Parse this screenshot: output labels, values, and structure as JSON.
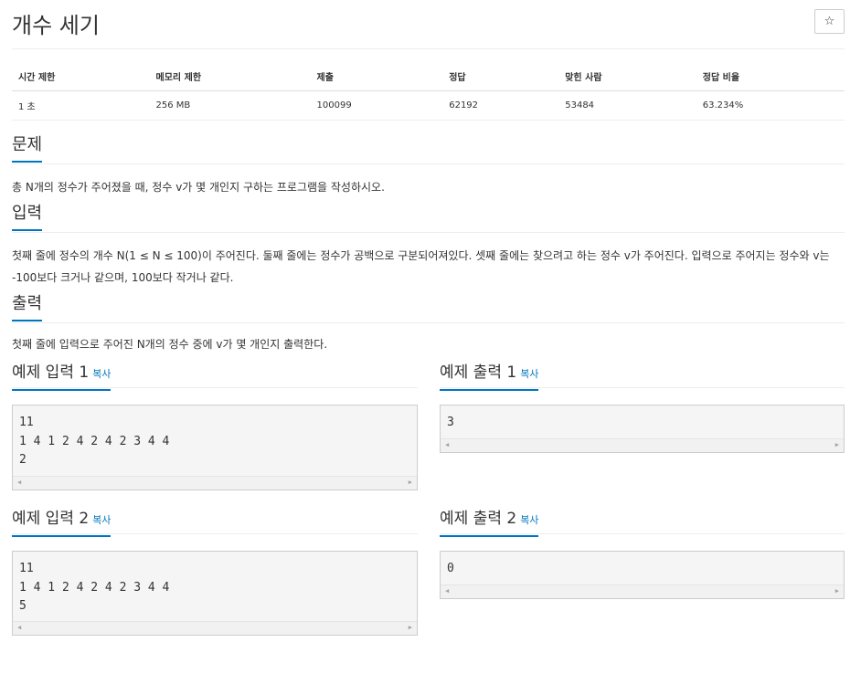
{
  "header": {
    "title": "개수 세기",
    "star_label": "☆"
  },
  "info_table": {
    "headers": [
      "시간 제한",
      "메모리 제한",
      "제출",
      "정답",
      "맞힌 사람",
      "정답 비율"
    ],
    "values": [
      "1 초",
      "256 MB",
      "100099",
      "62192",
      "53484",
      "63.234%"
    ]
  },
  "sections": {
    "problem": {
      "title": "문제",
      "text": "총 N개의 정수가 주어졌을 때, 정수 v가 몇 개인지 구하는 프로그램을 작성하시오."
    },
    "input": {
      "title": "입력",
      "text": "첫째 줄에 정수의 개수 N(1 ≤ N ≤ 100)이 주어진다. 둘째 줄에는 정수가 공백으로 구분되어져있다. 셋째 줄에는 찾으려고 하는 정수 v가 주어진다. 입력으로 주어지는 정수와 v는 -100보다 크거나 같으며, 100보다 작거나 같다."
    },
    "output": {
      "title": "출력",
      "text": "첫째 줄에 입력으로 주어진 N개의 정수 중에 v가 몇 개인지 출력한다."
    }
  },
  "examples": {
    "copy_label": "복사",
    "input1": {
      "title": "예제 입력 1",
      "lines": [
        "11",
        "1 4 1 2 4 2 4 2 3 4 4",
        "2"
      ]
    },
    "output1": {
      "title": "예제 출력 1",
      "lines": [
        "3"
      ]
    },
    "input2": {
      "title": "예제 입력 2",
      "lines": [
        "11",
        "1 4 1 2 4 2 4 2 3 4 4",
        "5"
      ]
    },
    "output2": {
      "title": "예제 출력 2",
      "lines": [
        "0"
      ]
    }
  },
  "scroll_arrows": {
    "left": "◀",
    "right": "▶"
  },
  "colors": {
    "accent": "#0076c0",
    "pre_background": "#f5f5f5",
    "border": "#cccccc"
  }
}
